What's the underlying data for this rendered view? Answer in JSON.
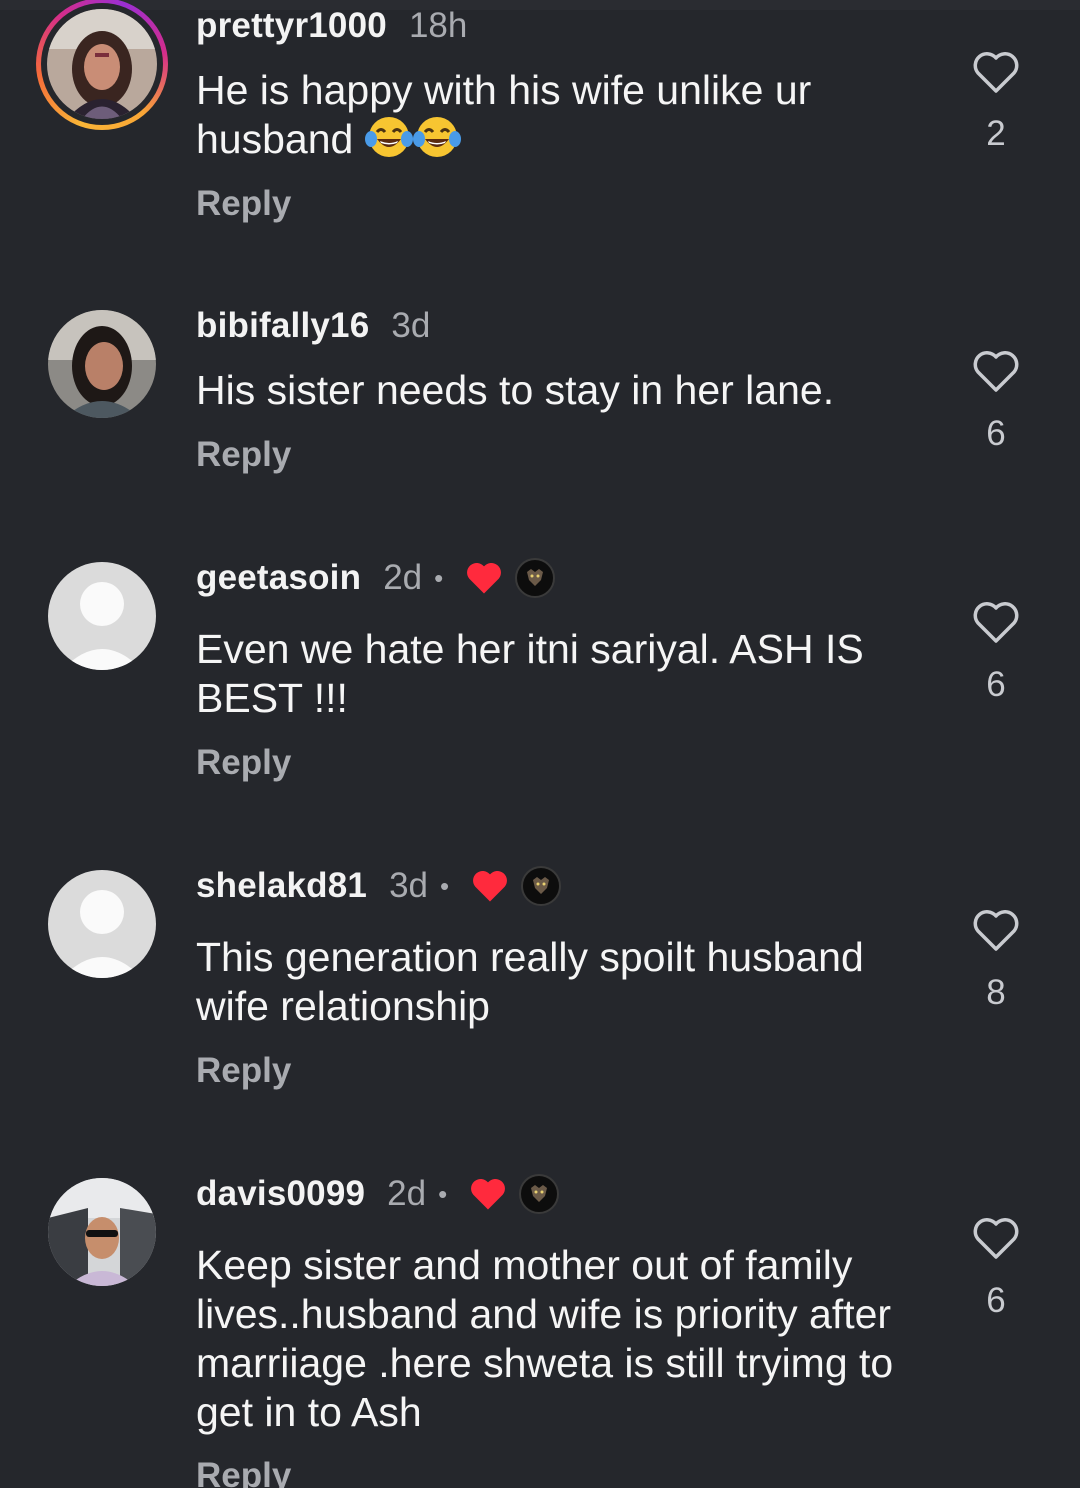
{
  "comments": [
    {
      "username": "prettyr1000",
      "time": "18h",
      "text": "He is happy with his wife unlike ur husband",
      "emoji": "😂😂",
      "reply": "Reply",
      "likes": "2",
      "has_story": true,
      "creator_liked": false
    },
    {
      "username": "bibifally16",
      "time": "3d",
      "text": "His sister needs to stay in her lane.",
      "reply": "Reply",
      "likes": "6",
      "has_story": false,
      "creator_liked": false
    },
    {
      "username": "geetasoin",
      "time": "2d",
      "separator": "•",
      "text": "Even we hate her itni sariyal.  ASH IS BEST !!!",
      "reply": "Reply",
      "likes": "6",
      "creator_liked": true
    },
    {
      "username": "shelakd81",
      "time": "3d",
      "separator": "•",
      "text": "This generation really spoilt husband wife relationship",
      "reply": "Reply",
      "likes": "8",
      "creator_liked": true
    },
    {
      "username": "davis0099",
      "time": "2d",
      "separator": "•",
      "text": "Keep sister and mother out of family lives..husband and wife is priority after marriiage .here shweta is still tryimg to get in to Ash",
      "reply": "Reply",
      "likes": "6",
      "creator_liked": true
    }
  ],
  "colors": {
    "background": "#25272c",
    "muted_text": "#a9abb0",
    "heart_red": "#ff2a3d"
  },
  "icons": {
    "like": "heart-outline-icon",
    "creator_like": "heart-filled-icon",
    "emoji": "face-with-tears-of-joy-emoji"
  }
}
